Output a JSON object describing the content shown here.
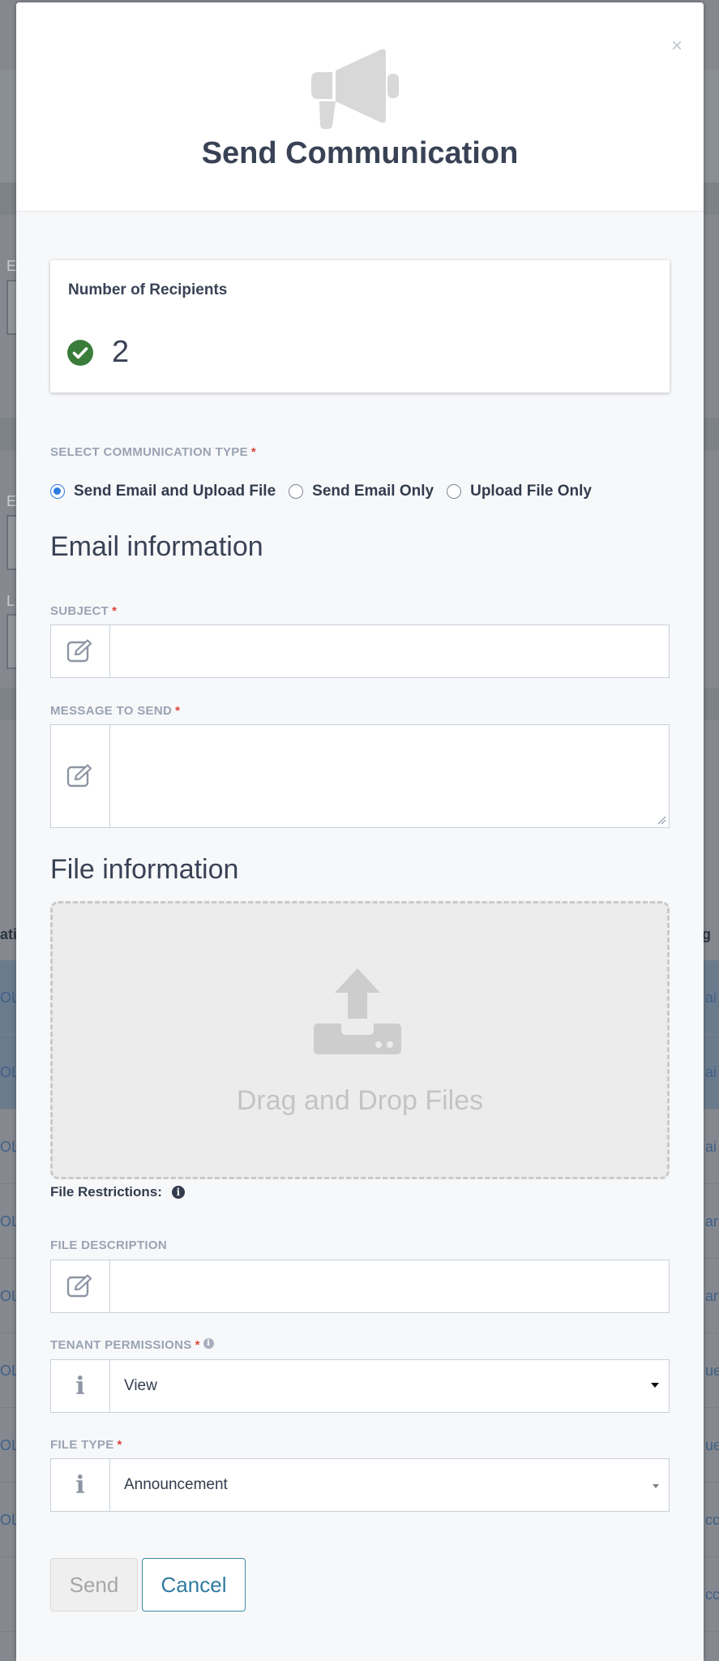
{
  "background": {
    "fragments": [
      "E",
      "E",
      "L",
      "ati",
      "g",
      "OL",
      "OL",
      "OL",
      "OL",
      "OL",
      "OL",
      "OL",
      "OL",
      "ai",
      "ai",
      "ai",
      "art",
      "art",
      "ue",
      "ue",
      "cc",
      "cc"
    ]
  },
  "modal": {
    "close_label": "×",
    "title": "Send Communication",
    "recipients": {
      "label": "Number of Recipients",
      "count": "2"
    },
    "communication_type": {
      "label": "SELECT COMMUNICATION TYPE",
      "required": "*",
      "options": [
        "Send Email and Upload File",
        "Send Email Only",
        "Upload File Only"
      ],
      "selected": "Send Email and Upload File"
    },
    "email_section": {
      "title": "Email information",
      "subject_label": "SUBJECT",
      "subject_value": "",
      "message_label": "MESSAGE TO SEND",
      "message_value": "",
      "required": "*"
    },
    "file_section": {
      "title": "File information",
      "dropzone_text": "Drag and Drop Files",
      "restrictions_label": "File Restrictions:",
      "description_label": "FILE DESCRIPTION",
      "description_value": "",
      "permissions_label": "TENANT PERMISSIONS",
      "permissions_value": "View",
      "file_type_label": "FILE TYPE",
      "file_type_value": "Announcement",
      "required": "*"
    },
    "buttons": {
      "send": "Send",
      "cancel": "Cancel"
    },
    "colors": {
      "success": "#3a7d3a",
      "radio_selected": "#2f7be0",
      "required_star": "#d9443c",
      "cancel_border": "#3a88a8"
    }
  }
}
